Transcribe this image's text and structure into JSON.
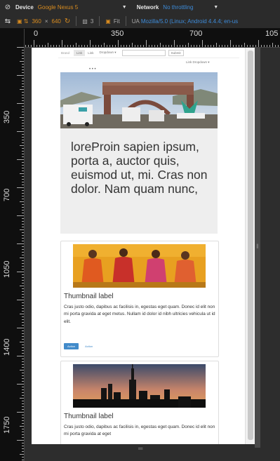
{
  "toolbar": {
    "device_label": "Device",
    "device_value": "Google Nexus 5",
    "network_label": "Network",
    "network_value": "No throttling",
    "width": "360",
    "times": "×",
    "height": "640",
    "dpr": "3",
    "fit_label": "Fit",
    "ua_label": "UA",
    "ua_value": "Mozilla/5.0 (Linux; Android 4.4.4; en-us"
  },
  "ruler": {
    "top": [
      "0",
      "350",
      "700",
      "105"
    ],
    "left": [
      "0",
      "350",
      "700",
      "1050",
      "1400",
      "1750"
    ]
  },
  "page": {
    "nav": {
      "brand": "Brand",
      "links": [
        "Link",
        "Link",
        "Dropdown ▾"
      ],
      "submit": "Submit",
      "right": "Link   Dropdown ▾"
    },
    "carousel_dots": "• • •",
    "jumbotron_text": "loreProin sapien ipsum, porta a, auctor quis, euismod ut, mi. Cras non dolor. Nam quam nunc,",
    "thumbnails": [
      {
        "title": "Thumbnail label",
        "text": "Cras justo odio, dapibus ac facilisis in, egestas eget quam. Donec id elit non mi porta gravida at eget metus. Nullam id dolor id nibh ultricies vehicula ut id elit.",
        "btn_primary": "Action",
        "btn_default": "Action"
      },
      {
        "title": "Thumbnail label",
        "text": "Cras justo odio, dapibus ac facilisis in, egestas eget quam. Donec id elit non mi porta gravida at eget"
      }
    ]
  },
  "colors": {
    "toolbar_bg": "#2b2b2b",
    "orange": "#d98c1f",
    "blue": "#3d8bd9",
    "jumbotron_bg": "#eeeeee",
    "btn_primary": "#428bca"
  }
}
